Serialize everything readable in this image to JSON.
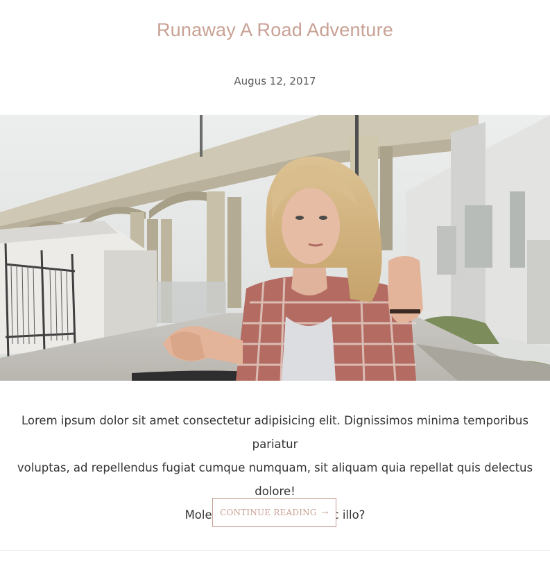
{
  "colors": {
    "accent": "#c8a194",
    "text": "#333333",
    "muted": "#5a5a5a",
    "divider": "#e6e6e6"
  },
  "post": {
    "title": "Runaway A Road Adventure",
    "date": "Augus 12, 2017",
    "excerpt_lines": [
      "Lorem ipsum dolor sit amet consectetur adipisicing elit. Dignissimos minima temporibus pariatur",
      "voluptas, ad repellendus fugiat cumque numquam, sit aliquam quia repellat quis delectus dolore!",
      "Molestias maxime alias hic illo?"
    ],
    "read_more_label": "CONTINUE READING",
    "read_more_icon": "arrow-right-icon",
    "image_icon": "hero-photo"
  }
}
